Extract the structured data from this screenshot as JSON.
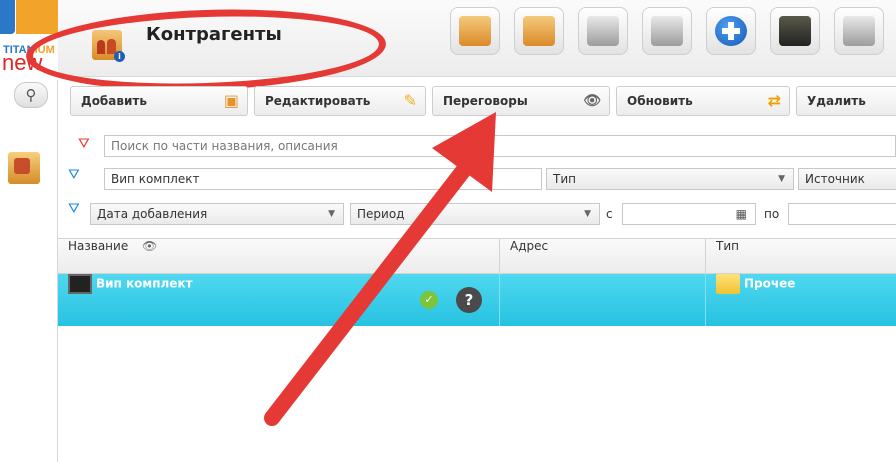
{
  "logo": {
    "top": "TITAN",
    "top_accent": "IUM",
    "bottom": "new"
  },
  "header": {
    "title": "Контрагенты"
  },
  "toolbar_icons": [
    {
      "name": "contractors-add-icon"
    },
    {
      "name": "contractors-info-icon"
    },
    {
      "name": "users-add-icon"
    },
    {
      "name": "users-info-icon"
    },
    {
      "name": "plus-icon"
    },
    {
      "name": "monitor-icon"
    },
    {
      "name": "download-icon"
    }
  ],
  "actions": {
    "add": "Добавить",
    "edit": "Редактировать",
    "negotiations": "Переговоры",
    "refresh": "Обновить",
    "delete": "Удалить"
  },
  "filters": {
    "search_placeholder": "Поиск по части названия, описания",
    "name_value": "Вип комплект",
    "type_label": "Тип",
    "source_label": "Источник",
    "date_field": "Дата добавления",
    "period": "Период",
    "from_label": "с",
    "to_label": "по"
  },
  "table": {
    "headers": {
      "name": "Название",
      "address": "Адрес",
      "type": "Тип"
    },
    "rows": [
      {
        "name": "Вип комплект",
        "address": "",
        "type": "Прочее"
      }
    ]
  },
  "colors": {
    "selected_row": "#27c2e2",
    "annotation": "#e53935",
    "accent": "#1e88e5"
  },
  "annotation": {
    "ellipse_target": "page-title",
    "arrow_target": "negotiations-button"
  }
}
